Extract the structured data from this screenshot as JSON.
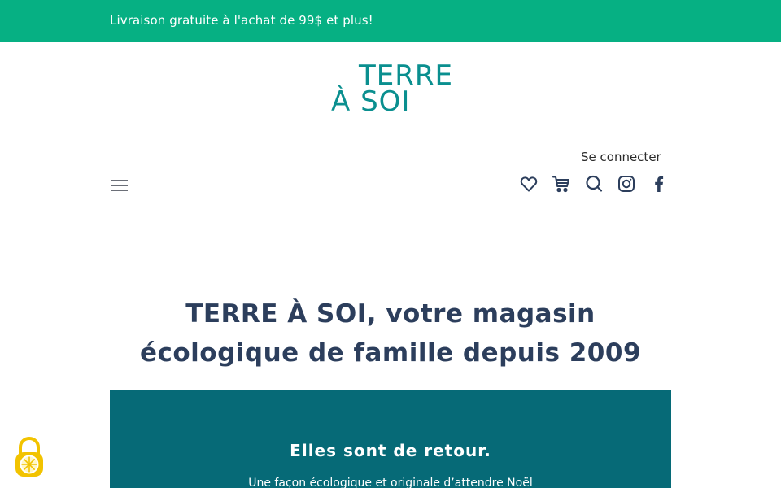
{
  "announcement": {
    "text": "Livraison gratuite à l'achat de 99$ et plus!"
  },
  "logo": {
    "line1": "TERRE",
    "line2": "À SOI"
  },
  "header": {
    "login_label": "Se connecter",
    "icons": [
      "menu-icon",
      "heart-icon",
      "cart-icon",
      "search-icon",
      "instagram-icon",
      "facebook-icon"
    ]
  },
  "hero": {
    "title": "TERRE À SOI, votre magasin écologique de famille depuis 2009"
  },
  "promo": {
    "title": "Elles sont de retour.",
    "subtitle": "Une façon écologique et originale d’attendre Noël"
  },
  "colors": {
    "topbar": "#06b083",
    "logo": "#0a8f8f",
    "heading": "#2c3e5c",
    "promo_bg": "#066a77",
    "cookie": "#f2c300"
  }
}
